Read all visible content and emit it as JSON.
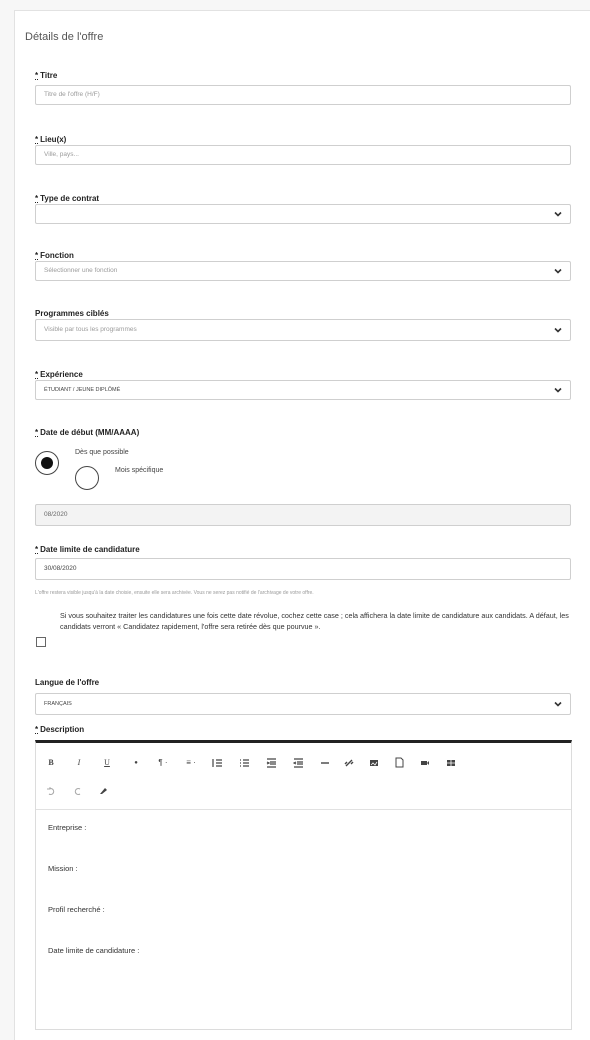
{
  "section_title": "Détails de l'offre",
  "required_marker": "*",
  "fields": {
    "titre": {
      "label": "Titre",
      "placeholder": "Titre de l'offre (H/F)"
    },
    "lieux": {
      "label": "Lieu(x)",
      "placeholder": "Ville, pays..."
    },
    "type_contrat": {
      "label": "Type de contrat",
      "value": ""
    },
    "fonction": {
      "label": "Fonction",
      "value": "Sélectionner une fonction"
    },
    "programmes": {
      "label": "Programmes ciblés",
      "value": "Visible par tous les programmes"
    },
    "experience": {
      "label": "Expérience",
      "value": "ÉTUDIANT / JEUNE DIPLÔMÉ"
    },
    "date_debut": {
      "label": "Date de début (MM/AAAA)",
      "options": [
        "Dès que possible",
        "Mois spécifique"
      ],
      "selected": "Dès que possible",
      "value": "08/2020"
    },
    "date_limite": {
      "label": "Date limite de candidature",
      "value": "30/08/2020"
    },
    "note": "L'offre restera visible jusqu'à la date choisie, ensuite elle sera archivée. Vous ne serez pas notifié de l'archivage de votre offre.",
    "checkbox_text": "Si vous souhaitez traiter les candidatures une fois cette date révolue, cochez cette case ; cela affichera la date limite de candidature aux candidats. A défaut, les candidats verront « Candidatez rapidement, l'offre sera retirée dès que pourvue ».",
    "checkbox_checked": false,
    "langue": {
      "label": "Langue de l'offre",
      "value": "FRANÇAIS"
    },
    "description": {
      "label": "Description",
      "toolbar": [
        "B",
        "I",
        "U",
        "●",
        "¶ ·",
        "≡ ·",
        "list-numbered",
        "list-bulleted",
        "indent",
        "outdent",
        "—",
        "link",
        "image",
        "file",
        "video",
        "table",
        "undo",
        "redo",
        "eraser"
      ],
      "content_lines": [
        "Entreprise :",
        "Mission :",
        "Profil recherché :",
        "Date limite de candidature :"
      ]
    }
  },
  "colors": {
    "border": "#cfcfcf",
    "label": "#222222",
    "placeholder": "#9b9b9b",
    "toolbar_top": "#222222"
  }
}
